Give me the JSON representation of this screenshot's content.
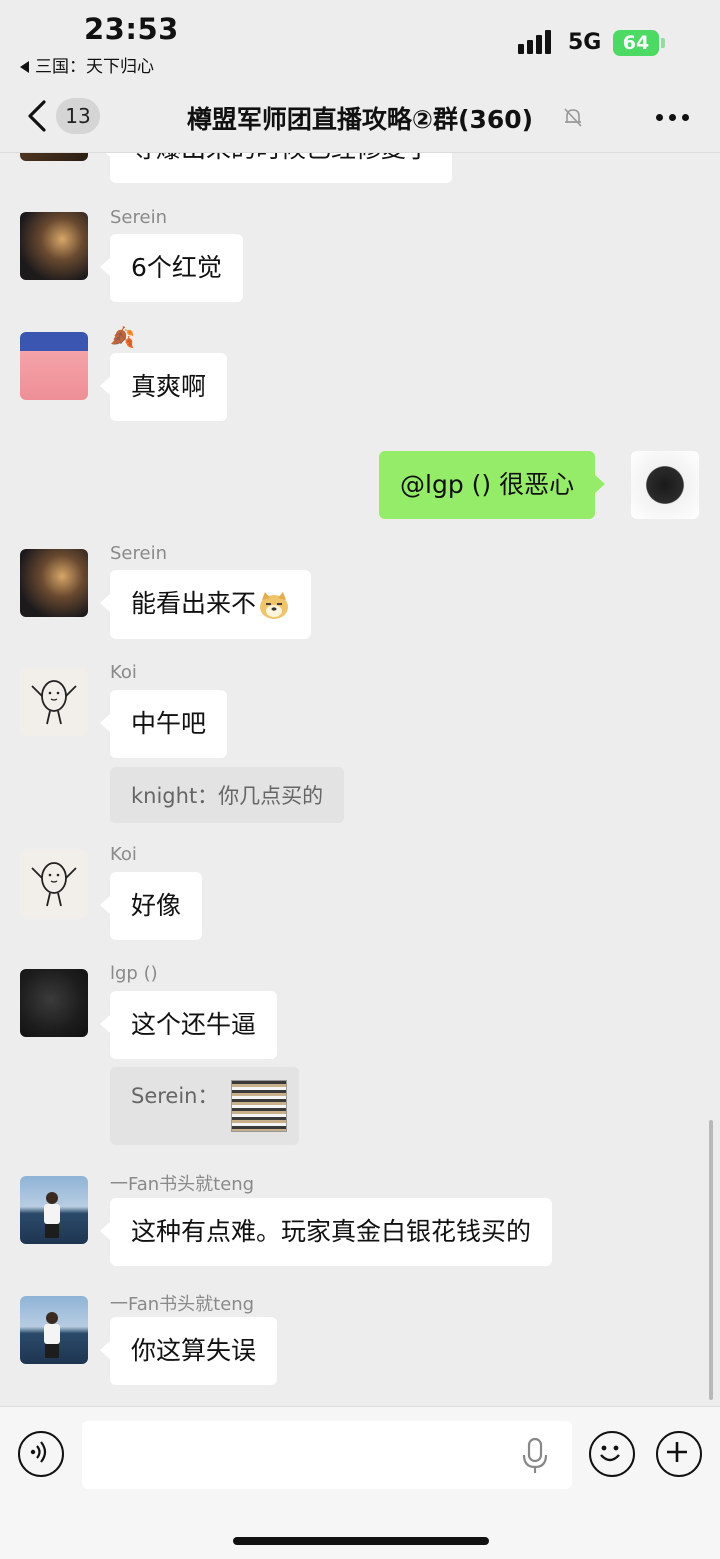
{
  "status_bar": {
    "time": "23:53",
    "back_app": "三国：天下归心",
    "network": "5G",
    "battery": "64"
  },
  "nav": {
    "unread_count": "13",
    "title": "樽盟军师团直播攻略②群(360)",
    "icons": [
      "back-chevron-icon",
      "mute-bell-icon",
      "more-dots-icon"
    ]
  },
  "messages": [
    {
      "text": "等爆出来的时候已经修复了"
    },
    {
      "sender": "Serein",
      "text": "6个红觉"
    },
    {
      "sender": "🍂",
      "text": "真爽啊"
    },
    {
      "text": "@lgp () 很恶心"
    },
    {
      "sender": "Serein",
      "text": "能看出来不"
    },
    {
      "sender": "Koi",
      "text": "中午吧",
      "quote": "knight：你几点买的"
    },
    {
      "sender": "Koi",
      "text": "好像"
    },
    {
      "sender": "lgp ()",
      "text": "这个还牛逼",
      "quote": "Serein："
    },
    {
      "sender": "一Fan书头就teng",
      "text": "这种有点难。玩家真金白银花钱买的"
    },
    {
      "sender": "一Fan书头就teng",
      "text": "你这算失误"
    }
  ],
  "input_bar": {
    "icons": [
      "voice-icon",
      "microphone-icon",
      "emoji-icon",
      "plus-icon"
    ]
  },
  "colors": {
    "background": "#ededed",
    "self_bubble": "#95ec69",
    "other_bubble": "#ffffff",
    "battery": "#4cd964"
  }
}
